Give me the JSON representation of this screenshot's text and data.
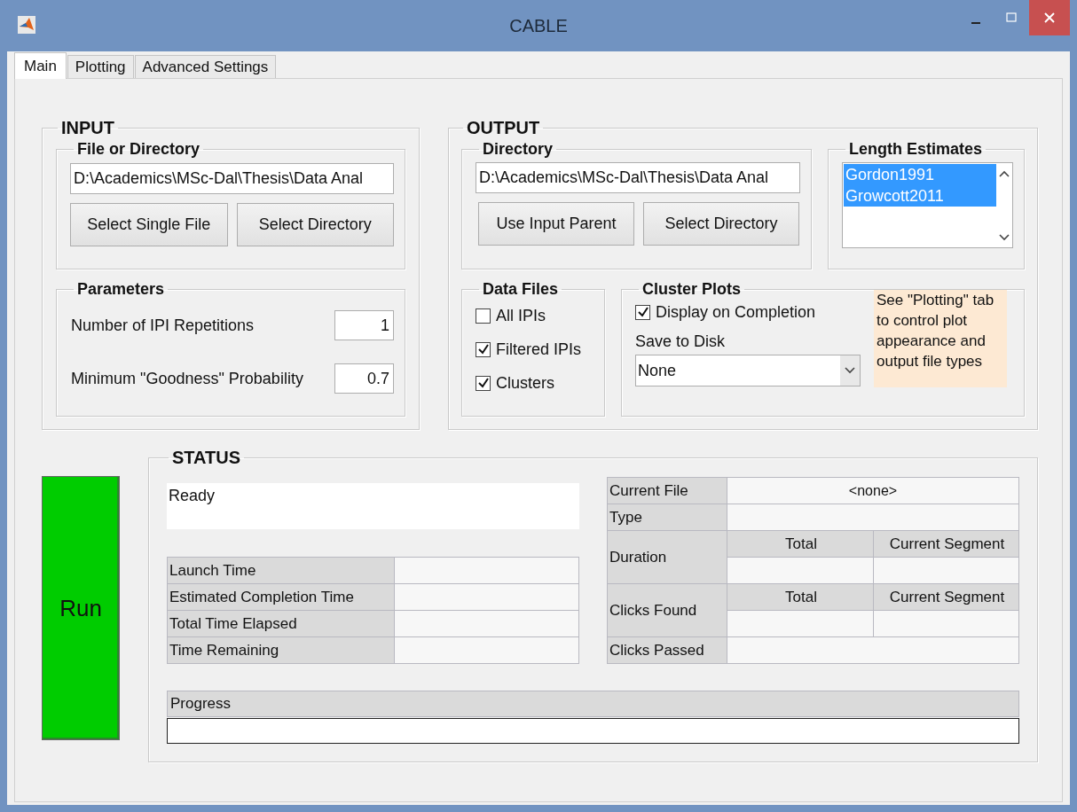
{
  "window": {
    "title": "CABLE"
  },
  "tabs": [
    {
      "label": "Main",
      "selected": true
    },
    {
      "label": "Plotting",
      "selected": false
    },
    {
      "label": "Advanced Settings",
      "selected": false
    }
  ],
  "input": {
    "title": "INPUT",
    "file_or_directory": {
      "title": "File or Directory",
      "path": "D:\\Academics\\MSc-Dal\\Thesis\\Data Anal",
      "buttons": [
        "Select Single File",
        "Select Directory"
      ]
    },
    "parameters": {
      "title": "Parameters",
      "rows": [
        {
          "label": "Number of IPI Repetitions",
          "value": "1"
        },
        {
          "label": "Minimum \"Goodness\" Probability",
          "value": "0.7"
        }
      ]
    }
  },
  "output": {
    "title": "OUTPUT",
    "directory": {
      "title": "Directory",
      "path": "D:\\Academics\\MSc-Dal\\Thesis\\Data Anal",
      "buttons": [
        "Use Input Parent",
        "Select Directory"
      ]
    },
    "length_estimates": {
      "title": "Length Estimates",
      "items": [
        {
          "label": "Gordon1991",
          "selected": true
        },
        {
          "label": "Growcott2011",
          "selected": true
        }
      ]
    },
    "data_files": {
      "title": "Data Files",
      "items": [
        {
          "label": "All IPIs",
          "checked": false
        },
        {
          "label": "Filtered IPIs",
          "checked": true
        },
        {
          "label": "Clusters",
          "checked": true
        }
      ]
    },
    "cluster_plots": {
      "title": "Cluster Plots",
      "display": {
        "label": "Display on Completion",
        "checked": true
      },
      "save_label": "Save to Disk",
      "save_value": "None",
      "note": "See \"Plotting\" tab to control plot appearance and output file types"
    }
  },
  "run_button": "Run",
  "status": {
    "title": "STATUS",
    "message": "Ready",
    "times": [
      "Launch Time",
      "Estimated Completion Time",
      "Total Time Elapsed",
      "Time Remaining"
    ],
    "file_info": {
      "current_file": {
        "label": "Current File",
        "value": "<none>"
      },
      "type_label": "Type",
      "duration": {
        "label": "Duration",
        "columns": [
          "Total",
          "Current Segment"
        ]
      },
      "clicks_found": {
        "label": "Clicks Found",
        "columns": [
          "Total",
          "Current Segment"
        ]
      },
      "clicks_passed_label": "Clicks Passed"
    },
    "progress": {
      "label": "Progress"
    }
  }
}
